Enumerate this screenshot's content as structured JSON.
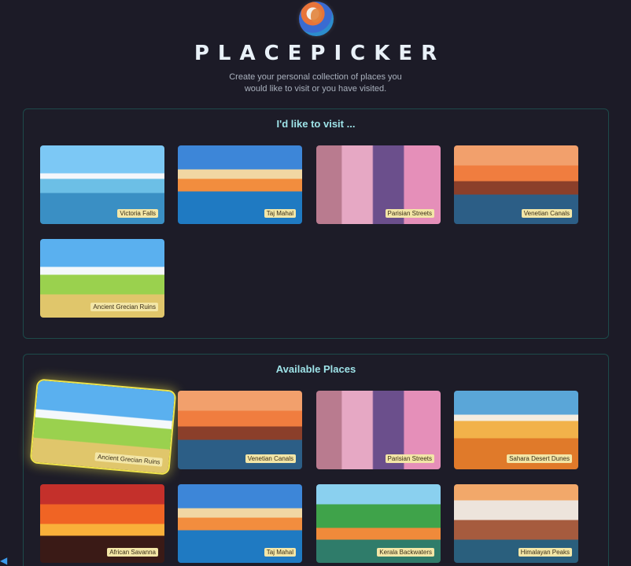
{
  "header": {
    "title": "PLACEPICKER",
    "tagline": "Create your personal collection of places you would like to visit or you have visited."
  },
  "sections": {
    "visit": {
      "title": "I'd like to visit ...",
      "places": [
        {
          "name": "Victoria Falls",
          "image": "sky-waterfall"
        },
        {
          "name": "Taj Mahal",
          "image": "sky-taj"
        },
        {
          "name": "Parisian Streets",
          "image": "sky-paris"
        },
        {
          "name": "Venetian Canals",
          "image": "sky-venice"
        },
        {
          "name": "Ancient Grecian Ruins",
          "image": "sky-greek"
        }
      ]
    },
    "available": {
      "title": "Available Places",
      "places": [
        {
          "name": "Ancient Grecian Ruins",
          "image": "sky-greek"
        },
        {
          "name": "Venetian Canals",
          "image": "sky-venice"
        },
        {
          "name": "Parisian Streets",
          "image": "sky-paris"
        },
        {
          "name": "Sahara Desert Dunes",
          "image": "sky-sahara"
        },
        {
          "name": "African Savanna",
          "image": "sky-savanna"
        },
        {
          "name": "Taj Mahal",
          "image": "sky-taj"
        },
        {
          "name": "Kerala Backwaters",
          "image": "sky-kerala"
        },
        {
          "name": "Himalayan Peaks",
          "image": "sky-himalaya"
        }
      ]
    }
  },
  "colors": {
    "background": "#1c1b27",
    "section_border": "#1d4a4a",
    "section_title": "#9ee3e8",
    "label_bg": "#f3e6a7",
    "highlight": "#f0e54a"
  },
  "icons": {
    "logo": "globe-logo-icon",
    "corner": "vscode-icon"
  }
}
